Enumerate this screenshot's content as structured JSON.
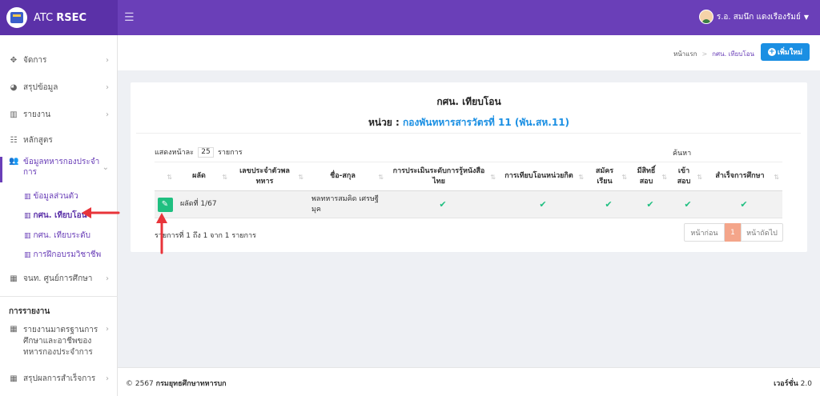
{
  "brand": {
    "prefix": "ATC",
    "name": "RSEC"
  },
  "user": {
    "name": "ร.อ. สมนึก แดงเรืองรัมย์"
  },
  "sidebar": {
    "items": [
      {
        "label": "จัดการ",
        "icon": "move-icon"
      },
      {
        "label": "สรุปข้อมูล",
        "icon": "pie-chart-icon"
      },
      {
        "label": "รายงาน",
        "icon": "bar-chart-icon"
      },
      {
        "label": "หลักสูตร",
        "icon": "list-icon"
      },
      {
        "label": "ข้อมูลทหารกองประจำการ",
        "icon": "users-icon"
      },
      {
        "label": "จนท. ศูนย์การศึกษา",
        "icon": "grid-icon"
      }
    ],
    "subitems": [
      {
        "label": "ข้อมูลส่วนตัว"
      },
      {
        "label": "กศน. เทียบโอน"
      },
      {
        "label": "กศน. เทียบระดับ"
      },
      {
        "label": "การฝึกอบรมวิชาชีพ"
      }
    ],
    "section_title": "การรายงาน",
    "report_items": [
      {
        "label": "รายงานมาตรฐานการศึกษาและอาชีพของทหารกองประจำการ"
      },
      {
        "label": "สรุปผลการสำเร็จการ"
      }
    ]
  },
  "breadcrumb": {
    "home": "หน้าแรก",
    "current": "กศน. เทียบโอน"
  },
  "add_button": "เพิ่มใหม่",
  "card": {
    "title": "กศน. เทียบโอน",
    "unit_prefix": "หน่วย :",
    "unit_name": "กองพันทหารสารวัตรที่ 11 (พัน.สห.11)"
  },
  "table_controls": {
    "show_prefix": "แสดงหน้าละ",
    "page_length": "25",
    "show_suffix": "รายการ",
    "search_label": "ค้นหา"
  },
  "table": {
    "headers": [
      "",
      "ผลัด",
      "เลขประจำตัวพลทหาร",
      "ชื่อ-สกุล",
      "การประเมินระดับการรู้หนังสือไทย",
      "การเทียบโอนหน่วยกิต",
      "สมัครเรียน",
      "มีสิทธิ์สอบ",
      "เข้าสอบ",
      "สำเร็จการศึกษา"
    ],
    "rows": [
      {
        "round": "ผลัดที่ 1/67",
        "soldier_id": "",
        "name": "พลทหารสมคิด เศรษฐีมุค"
      }
    ]
  },
  "table_info": "รายการที่ 1 ถึง 1 จาก 1 รายการ",
  "pagination": {
    "prev": "หน้าก่อน",
    "current": "1",
    "next": "หน้าถัดไป"
  },
  "footer": {
    "copyright": "© 2567",
    "org": "กรมยุทธศึกษาทหารบก",
    "version_label": "เวอร์ชั่น",
    "version": "2.0"
  },
  "colors": {
    "primary": "#6a3fb8",
    "accent": "#1a8fe3",
    "success": "#1fbf80",
    "annotation": "#e8343a"
  }
}
